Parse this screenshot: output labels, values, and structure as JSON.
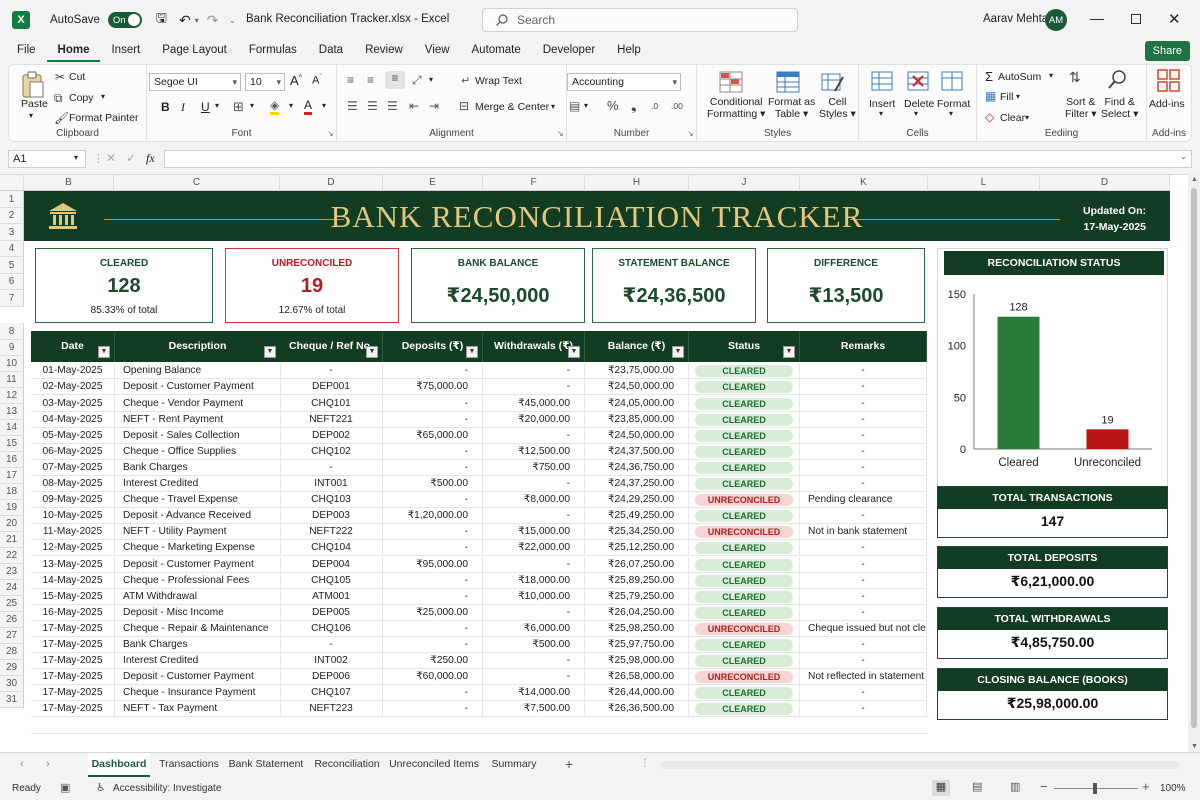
{
  "titlebar": {
    "autosave_label": "AutoSave",
    "autosave_state": "On",
    "filename": "Bank Reconciliation Tracker.xlsx",
    "app": "Excel",
    "search_placeholder": "Search",
    "user_name": "Aarav Mehta",
    "user_initials": "AM"
  },
  "menu": [
    "File",
    "Home",
    "Insert",
    "Page Layout",
    "Formulas",
    "Data",
    "Review",
    "View",
    "Automate",
    "Developer",
    "Help"
  ],
  "menu_active": "Home",
  "share_label": "Share",
  "ribbon": {
    "clipboard": {
      "paste": "Paste",
      "cut": "Cut",
      "copy": "Copy",
      "format_painter": "Format Painter",
      "label": "Clipboard"
    },
    "font": {
      "family": "Segoe UI",
      "size": "10",
      "label": "Font"
    },
    "alignment": {
      "wrap": "Wrap Text",
      "merge": "Merge & Center",
      "label": "Alignment"
    },
    "number": {
      "format": "Accounting",
      "label": "Number"
    },
    "styles": {
      "cond1": "Conditional",
      "cond2": "Formatting",
      "fmt1": "Format as",
      "fmt2": "Table",
      "cell1": "Cell",
      "cell2": "Styles",
      "label": "Styles"
    },
    "cells": {
      "insert": "Insert",
      "delete": "Delete",
      "format": "Format",
      "label": "Cells"
    },
    "editing": {
      "autosum": "AutoSum",
      "fill": "Fill",
      "clear": "Clear",
      "sort1": "Sort &",
      "sort2": "Filter",
      "find1": "Find &",
      "find2": "Select",
      "label": "Eediing"
    },
    "addins": {
      "name": "Add-ins",
      "label": "Add-ins"
    }
  },
  "formula_bar": {
    "name_box": "A1",
    "fx": "fx"
  },
  "columns": [
    "B",
    "C",
    "D",
    "E",
    "F",
    "H",
    "J",
    "K",
    "L",
    "D"
  ],
  "rows": [
    "1",
    "2",
    "3",
    "4",
    "5",
    "6",
    "7",
    "8",
    "9",
    "10",
    "11",
    "12",
    "13",
    "14",
    "15",
    "16",
    "17",
    "18",
    "19",
    "20",
    "21",
    "22",
    "23",
    "24",
    "25",
    "26",
    "27",
    "28",
    "29",
    "30",
    "31"
  ],
  "banner": {
    "title": "BANK RECONCILIATION TRACKER",
    "updated_label": "Updated On:",
    "updated_date": "17-May-2025"
  },
  "kpis": [
    {
      "title": "CLEARED",
      "value": "128",
      "sub": "85.33% of total",
      "tone": "green"
    },
    {
      "title": "UNRECONCILED",
      "value": "19",
      "sub": "12.67% of total",
      "tone": "red"
    },
    {
      "title": "BANK BALANCE",
      "value": "₹24,50,000",
      "sub": "",
      "tone": "green"
    },
    {
      "title": "STATEMENT BALANCE",
      "value": "₹24,36,500",
      "sub": "",
      "tone": "green"
    },
    {
      "title": "DIFFERENCE",
      "value": "₹13,500",
      "sub": "",
      "tone": "green"
    }
  ],
  "table": {
    "headers": [
      "Date",
      "Description",
      "Cheque / Ref No.",
      "Deposits (₹)",
      "Withdrawals (₹)",
      "Balance (₹)",
      "Status",
      "Remarks"
    ],
    "rows": [
      [
        "01-May-2025",
        "Opening Balance",
        "-",
        "-",
        "-",
        "₹23,75,000.00",
        "CLEARED",
        "-"
      ],
      [
        "02-May-2025",
        "Deposit - Customer Payment",
        "DEP001",
        "₹75,000.00",
        "-",
        "₹24,50,000.00",
        "CLEARED",
        "-"
      ],
      [
        "03-May-2025",
        "Cheque - Vendor Payment",
        "CHQ101",
        "-",
        "₹45,000.00",
        "₹24,05,000.00",
        "CLEARED",
        "-"
      ],
      [
        "04-May-2025",
        "NEFT - Rent Payment",
        "NEFT221",
        "-",
        "₹20,000.00",
        "₹23,85,000.00",
        "CLEARED",
        "-"
      ],
      [
        "05-May-2025",
        "Deposit - Sales Collection",
        "DEP002",
        "₹65,000.00",
        "-",
        "₹24,50,000.00",
        "CLEARED",
        "-"
      ],
      [
        "06-May-2025",
        "Cheque - Office Supplies",
        "CHQ102",
        "-",
        "₹12,500.00",
        "₹24,37,500.00",
        "CLEARED",
        "-"
      ],
      [
        "07-May-2025",
        "Bank Charges",
        "-",
        "-",
        "₹750.00",
        "₹24,36,750.00",
        "CLEARED",
        "-"
      ],
      [
        "08-May-2025",
        "Interest Credited",
        "INT001",
        "₹500.00",
        "-",
        "₹24,37,250.00",
        "CLEARED",
        "-"
      ],
      [
        "09-May-2025",
        "Cheque - Travel Expense",
        "CHQ103",
        "-",
        "₹8,000.00",
        "₹24,29,250.00",
        "UNRECONCILED",
        "Pending clearance"
      ],
      [
        "10-May-2025",
        "Deposit - Advance Received",
        "DEP003",
        "₹1,20,000.00",
        "-",
        "₹25,49,250.00",
        "CLEARED",
        "-"
      ],
      [
        "11-May-2025",
        "NEFT - Utility Payment",
        "NEFT222",
        "-",
        "₹15,000.00",
        "₹25,34,250.00",
        "UNRECONCILED",
        "Not in bank statement"
      ],
      [
        "12-May-2025",
        "Cheque - Marketing Expense",
        "CHQ104",
        "-",
        "₹22,000.00",
        "₹25,12,250.00",
        "CLEARED",
        "-"
      ],
      [
        "13-May-2025",
        "Deposit - Customer Payment",
        "DEP004",
        "₹95,000.00",
        "-",
        "₹26,07,250.00",
        "CLEARED",
        "-"
      ],
      [
        "14-May-2025",
        "Cheque - Professional Fees",
        "CHQ105",
        "-",
        "₹18,000.00",
        "₹25,89,250.00",
        "CLEARED",
        "-"
      ],
      [
        "15-May-2025",
        "ATM Withdrawal",
        "ATM001",
        "-",
        "₹10,000.00",
        "₹25,79,250.00",
        "CLEARED",
        "-"
      ],
      [
        "16-May-2025",
        "Deposit - Misc Income",
        "DEP005",
        "₹25,000.00",
        "-",
        "₹26,04,250.00",
        "CLEARED",
        "-"
      ],
      [
        "17-May-2025",
        "Cheque - Repair & Maintenance",
        "CHQ106",
        "-",
        "₹6,000.00",
        "₹25,98,250.00",
        "UNRECONCILED",
        "Cheque issued but not cleared"
      ],
      [
        "17-May-2025",
        "Bank Charges",
        "-",
        "-",
        "₹500.00",
        "₹25,97,750.00",
        "CLEARED",
        "-"
      ],
      [
        "17-May-2025",
        "Interest Credited",
        "INT002",
        "₹250.00",
        "-",
        "₹25,98,000.00",
        "CLEARED",
        "-"
      ],
      [
        "17-May-2025",
        "Deposit - Customer Payment",
        "DEP006",
        "₹60,000.00",
        "-",
        "₹26,58,000.00",
        "UNRECONCILED",
        "Not reflected in statement"
      ],
      [
        "17-May-2025",
        "Cheque - Insurance Payment",
        "CHQ107",
        "-",
        "₹14,000.00",
        "₹26,44,000.00",
        "CLEARED",
        "-"
      ],
      [
        "17-May-2025",
        "NEFT - Tax Payment",
        "NEFT223",
        "-",
        "₹7,500.00",
        "₹26,36,500.00",
        "CLEARED",
        "-"
      ]
    ]
  },
  "status_panel": {
    "title": "RECONCILIATION STATUS"
  },
  "chart_data": {
    "type": "bar",
    "categories": [
      "Cleared",
      "Unreconciled"
    ],
    "values": [
      128,
      19
    ],
    "ylim": [
      0,
      150
    ],
    "yticks": [
      0,
      50,
      100,
      150
    ],
    "colors": [
      "#2a7a39",
      "#b81414"
    ],
    "data_labels": [
      "128",
      "19"
    ]
  },
  "summary": [
    {
      "title": "TOTAL TRANSACTIONS",
      "value": "147"
    },
    {
      "title": "TOTAL DEPOSITS",
      "value": "₹6,21,000.00"
    },
    {
      "title": "TOTAL WITHDRAWALS",
      "value": "₹4,85,750.00"
    },
    {
      "title": "CLOSING BALANCE (BOOKS)",
      "value": "₹25,98,000.00"
    }
  ],
  "sheet_tabs": [
    "Dashboard",
    "Transactions",
    "Bank Statement",
    "Reconciliation",
    "Unreconciled Items",
    "Summary"
  ],
  "sheet_active": "Dashboard",
  "statusbar": {
    "ready": "Ready",
    "accessibility": "Accessibility: Investigate",
    "zoom": "100%"
  }
}
